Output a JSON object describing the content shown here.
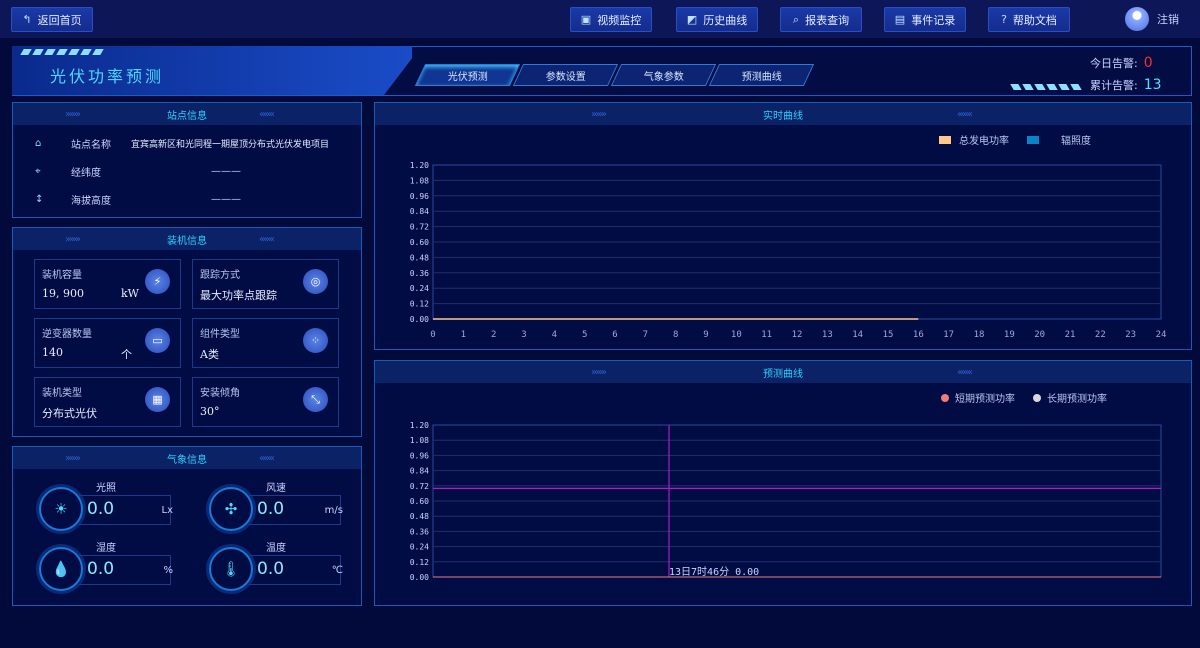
{
  "topbar": {
    "back": "返回首页",
    "nav": [
      {
        "label": "视频监控",
        "icon": "video-icon"
      },
      {
        "label": "历史曲线",
        "icon": "chart-icon"
      },
      {
        "label": "报表查询",
        "icon": "search-icon"
      },
      {
        "label": "事件记录",
        "icon": "document-icon"
      },
      {
        "label": "帮助文档",
        "icon": "help-icon"
      }
    ],
    "logout": "注销"
  },
  "header": {
    "title": "光伏功率预测",
    "tabs": [
      "光伏预测",
      "参数设置",
      "气象参数",
      "预测曲线"
    ],
    "active_tab": 0,
    "alerts": {
      "today_label": "今日告警:",
      "today": "0",
      "total_label": "累计告警:",
      "total": "13"
    }
  },
  "site": {
    "title": "站点信息",
    "rows": [
      {
        "label": "站点名称",
        "value": "宜宾高新区和光同程一期屋顶分布式光伏发电项目"
      },
      {
        "label": "经纬度",
        "value": "———"
      },
      {
        "label": "海拔高度",
        "value": "———"
      }
    ]
  },
  "install": {
    "title": "装机信息",
    "cards": [
      {
        "label": "装机容量",
        "value": "19, 900",
        "unit": "kW"
      },
      {
        "label": "跟踪方式",
        "value": "最大功率点跟踪",
        "unit": ""
      },
      {
        "label": "逆变器数量",
        "value": "140",
        "unit": "个"
      },
      {
        "label": "组件类型",
        "value": "A类",
        "unit": ""
      },
      {
        "label": "装机类型",
        "value": "分布式光伏",
        "unit": ""
      },
      {
        "label": "安装倾角",
        "value": "30°",
        "unit": ""
      }
    ]
  },
  "weather": {
    "title": "气象信息",
    "items": [
      {
        "label": "光照",
        "value": "0.0",
        "unit": "Lx"
      },
      {
        "label": "风速",
        "value": "0.0",
        "unit": "m/s"
      },
      {
        "label": "湿度",
        "value": "0.0",
        "unit": "%"
      },
      {
        "label": "温度",
        "value": "0.0",
        "unit": "℃"
      }
    ]
  },
  "colors": {
    "accent": "#2ed0ff",
    "alert_red": "#ff2a2a",
    "alert_cyan": "#4fe0ff"
  },
  "chart_data": [
    {
      "type": "line",
      "title": "实时曲线",
      "legend": [
        "总发电功率",
        "辐照度"
      ],
      "legend_colors": [
        "#ffc98a",
        "#0a84c8"
      ],
      "x": [
        0,
        1,
        2,
        3,
        4,
        5,
        6,
        7,
        8,
        9,
        10,
        11,
        12,
        13,
        14,
        15,
        16,
        17,
        18,
        19,
        20,
        21,
        22,
        23,
        24
      ],
      "yticks": [
        "0.00",
        "0.12",
        "0.24",
        "0.36",
        "0.48",
        "0.60",
        "0.72",
        "0.84",
        "0.96",
        "1.08",
        "1.20"
      ],
      "ylim": [
        0,
        1.2
      ],
      "xlim": [
        0,
        24
      ],
      "series": [
        {
          "name": "总发电功率",
          "x": [
            0,
            16
          ],
          "values": [
            0,
            0
          ]
        }
      ]
    },
    {
      "type": "line",
      "title": "预测曲线",
      "legend": [
        "短期预测功率",
        "长期预测功率"
      ],
      "legend_colors": [
        "#f27a7a",
        "#d8d8d8"
      ],
      "yticks": [
        "0.00",
        "0.12",
        "0.24",
        "0.36",
        "0.48",
        "0.60",
        "0.72",
        "0.84",
        "0.96",
        "1.08",
        "1.20"
      ],
      "ylim": [
        0,
        1.2
      ],
      "crosshair_y": 0.7,
      "tooltip": "13日7时46分    0.00"
    }
  ]
}
